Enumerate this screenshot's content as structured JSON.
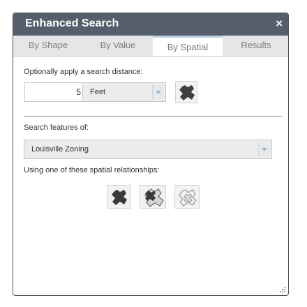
{
  "window": {
    "title": "Enhanced Search",
    "close_glyph": "×"
  },
  "tabs": [
    {
      "label": "By Shape",
      "active": false
    },
    {
      "label": "By Value",
      "active": false
    },
    {
      "label": "By Spatial",
      "active": true
    },
    {
      "label": "Results",
      "active": false
    }
  ],
  "distance": {
    "label": "Optionally apply a search distance:",
    "value": "5",
    "unit": "Feet"
  },
  "features": {
    "label": "Search features of:",
    "layer": "Louisville Zoning"
  },
  "relationships": {
    "label": "Using one of these spatial relationships:",
    "icons": [
      "intersects-icon",
      "contains-icon",
      "within-icon"
    ]
  },
  "colors": {
    "titlebar": "#555f6c",
    "accent": "#b8d2e0",
    "tab_bar": "#e5e6e8"
  }
}
